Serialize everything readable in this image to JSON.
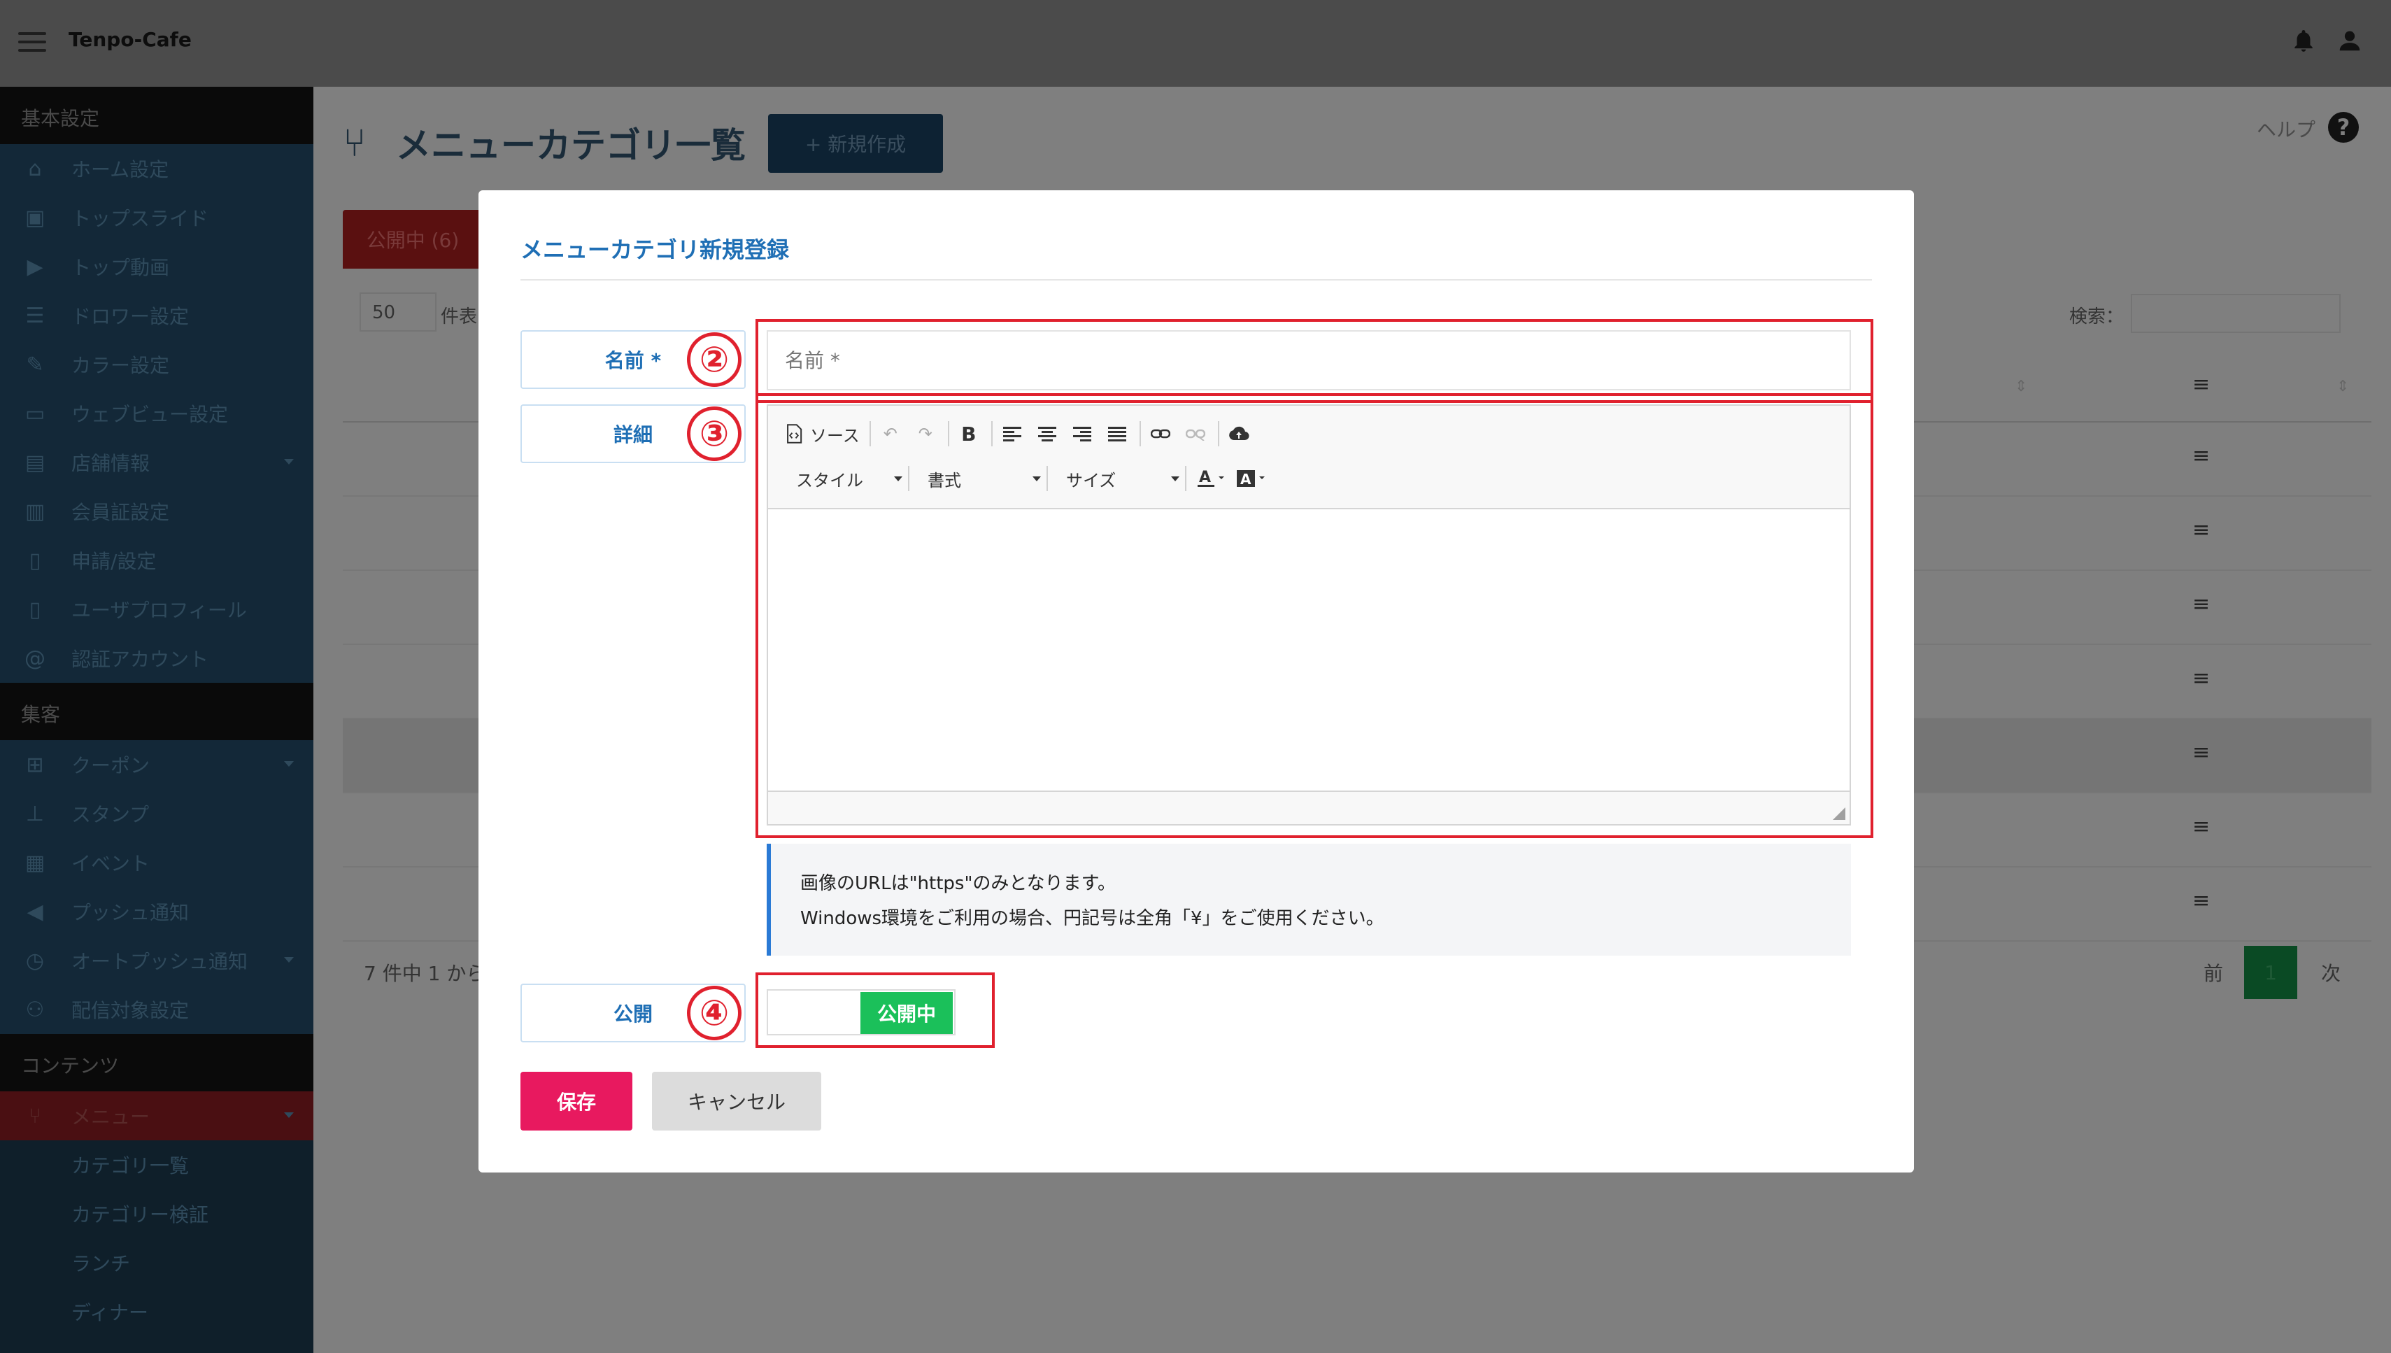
{
  "app": {
    "brand": "Tenpo-Cafe"
  },
  "sidebar": {
    "sections": [
      {
        "title": "基本設定",
        "items": [
          {
            "label": "ホーム設定",
            "icon": "home-icon"
          },
          {
            "label": "トップスライド",
            "icon": "image-icon"
          },
          {
            "label": "トップ動画",
            "icon": "video-icon"
          },
          {
            "label": "ドロワー設定",
            "icon": "list-icon"
          },
          {
            "label": "カラー設定",
            "icon": "pencil-icon"
          },
          {
            "label": "ウェブビュー設定",
            "icon": "browser-icon"
          },
          {
            "label": "店舗情報",
            "icon": "store-icon"
          },
          {
            "label": "会員証設定",
            "icon": "id-card-icon"
          },
          {
            "label": "申請/設定",
            "icon": "document-icon"
          },
          {
            "label": "ユーザプロフィール",
            "icon": "profile-doc-icon"
          },
          {
            "label": "認証アカウント",
            "icon": "at-icon"
          }
        ]
      },
      {
        "title": "集客",
        "items": [
          {
            "label": "クーポン",
            "icon": "gift-icon"
          },
          {
            "label": "スタンプ",
            "icon": "stamp-icon"
          },
          {
            "label": "イベント",
            "icon": "calendar-icon"
          },
          {
            "label": "プッシュ通知",
            "icon": "megaphone-icon"
          },
          {
            "label": "オートプッシュ通知",
            "icon": "clock-icon"
          },
          {
            "label": "配信対象設定",
            "icon": "users-icon"
          }
        ]
      },
      {
        "title": "コンテンツ",
        "items": [
          {
            "label": "メニュー",
            "icon": "utensils-icon"
          }
        ]
      }
    ],
    "sub_items": [
      "カテゴリ一覧",
      "カテゴリー検証",
      "ランチ",
      "ディナー"
    ]
  },
  "main": {
    "title": "メニューカテゴリ一覧",
    "new_button": "+ 新規作成",
    "help": "ヘルプ",
    "tab_published": "公開中 (6)",
    "per_page": "50",
    "per_page_suffix": "件表",
    "search_label": "検索：",
    "info": "7 件中 1 から",
    "prev": "前",
    "page": "1",
    "next": "次"
  },
  "modal": {
    "title": "メニューカテゴリ新規登録",
    "name_label": "名前 *",
    "name_placeholder": "名前 *",
    "detail_label": "詳細",
    "publish_label": "公開",
    "badges": {
      "name": "②",
      "detail": "③",
      "publish": "④"
    },
    "toolbar": {
      "source": "ソース",
      "style": "スタイル",
      "format": "書式",
      "size": "サイズ"
    },
    "note_line1": "画像のURLは\"https\"のみとなります。",
    "note_line2": "Windows環境をご利用の場合、円記号は全角「¥」をご使用ください。",
    "toggle_label": "公開中",
    "save": "保存",
    "cancel": "キャンセル"
  },
  "colors": {
    "accent": "#1f6fb5",
    "highlight": "#e0212e",
    "toggle_on": "#1bc05a",
    "save": "#e8195f"
  }
}
